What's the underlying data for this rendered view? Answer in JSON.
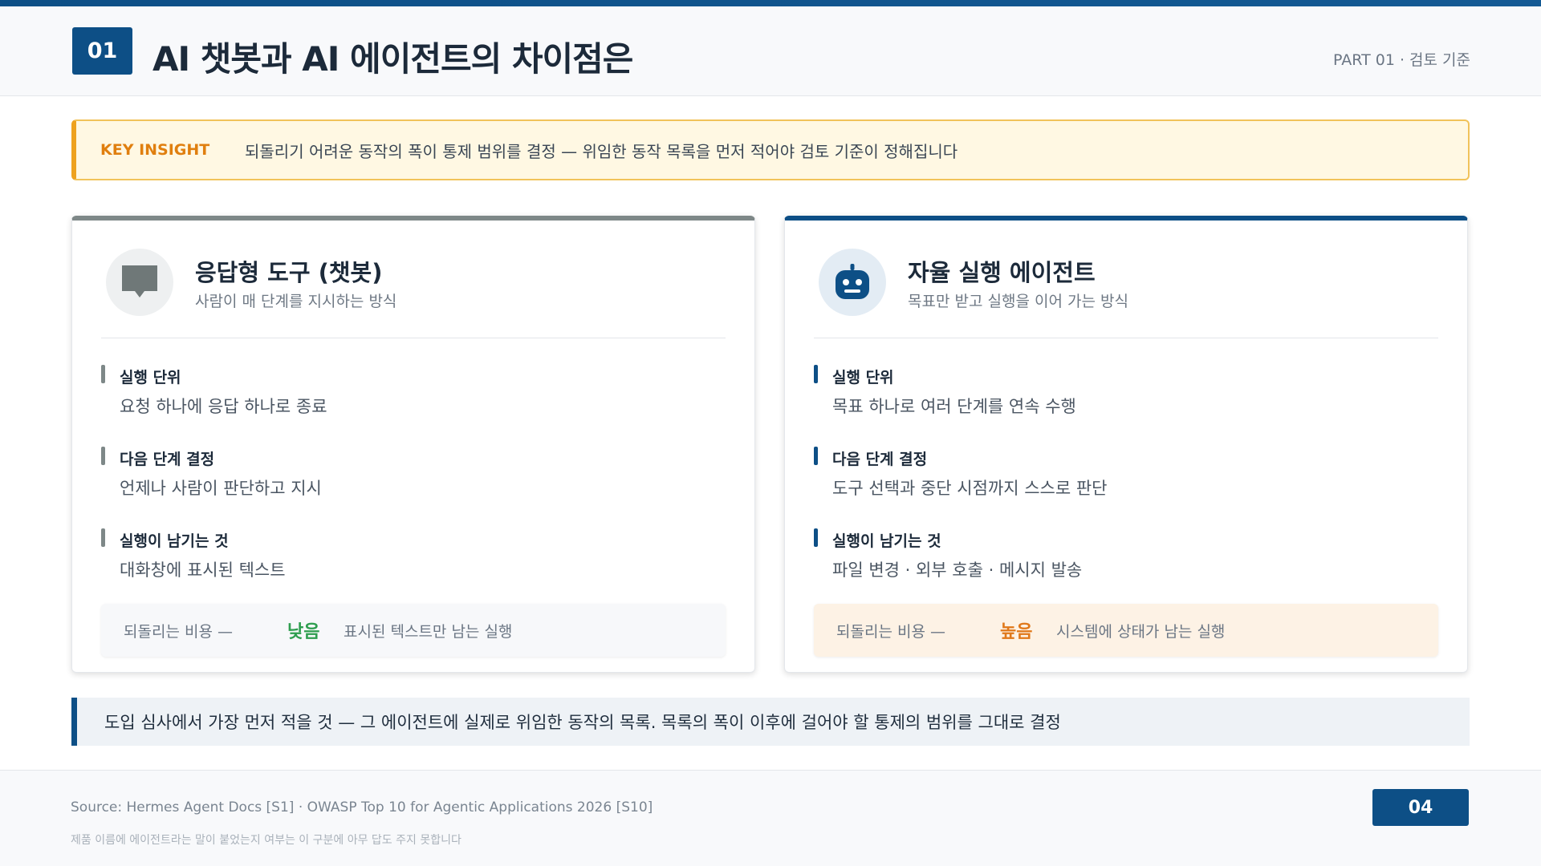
{
  "header": {
    "section_number": "01",
    "title": "AI 챗봇과 AI 에이전트의 차이점은",
    "part_label": "PART 01 · 검토 기준"
  },
  "insight": {
    "label": "KEY INSIGHT",
    "text": "되돌리기 어려운 동작의 폭이 통제 범위를 결정 — 위임한 동작 목록을 먼저 적어야 검토 기준이 정해집니다"
  },
  "cards": {
    "chatbot": {
      "icon": "chat-bubble-icon",
      "title": "응답형 도구 (챗봇)",
      "subtitle": "사람이 매 단계를 지시하는 방식",
      "features": [
        {
          "label": "실행 단위",
          "value": "요청 하나에 응답 하나로 종료"
        },
        {
          "label": "다음 단계 결정",
          "value": "언제나 사람이 판단하고 지시"
        },
        {
          "label": "실행이 남기는 것",
          "value": "대화창에 표시된 텍스트"
        }
      ],
      "cost": {
        "label": "되돌리는 비용 —",
        "level": "낮음",
        "level_color": "#2e9e4f",
        "description": "표시된 텍스트만 남는 실행"
      }
    },
    "agent": {
      "icon": "robot-icon",
      "title": "자율 실행 에이전트",
      "subtitle": "목표만 받고 실행을 이어 가는 방식",
      "features": [
        {
          "label": "실행 단위",
          "value": "목표 하나로 여러 단계를 연속 수행"
        },
        {
          "label": "다음 단계 결정",
          "value": "도구 선택과 중단 시점까지 스스로 판단"
        },
        {
          "label": "실행이 남기는 것",
          "value": "파일 변경 · 외부 호출 · 메시지 발송"
        }
      ],
      "cost": {
        "label": "되돌리는 비용 —",
        "level": "높음",
        "level_color": "#e0781a",
        "description": "시스템에 상태가 남는 실행"
      }
    }
  },
  "bottom_note": "도입 심사에서 가장 먼저 적을 것 — 그 에이전트에 실제로 위임한 동작의 목록. 목록의 폭이 이후에 걸어야 할 통제의 범위를 그대로 결정",
  "footer": {
    "source": "Source: Hermes Agent Docs [S1] · OWASP Top 10 for Agentic Applications 2026 [S10]",
    "footnote": "제품 이름에 에이전트라는 말이 붙었는지 여부는 이 구분에 아무 답도 주지 못합니다",
    "page_number": "04"
  },
  "colors": {
    "primary": "#0d4f86",
    "accent_gray": "#7e8888",
    "insight_accent": "#eea21f",
    "insight_label": "#e07f0f"
  }
}
